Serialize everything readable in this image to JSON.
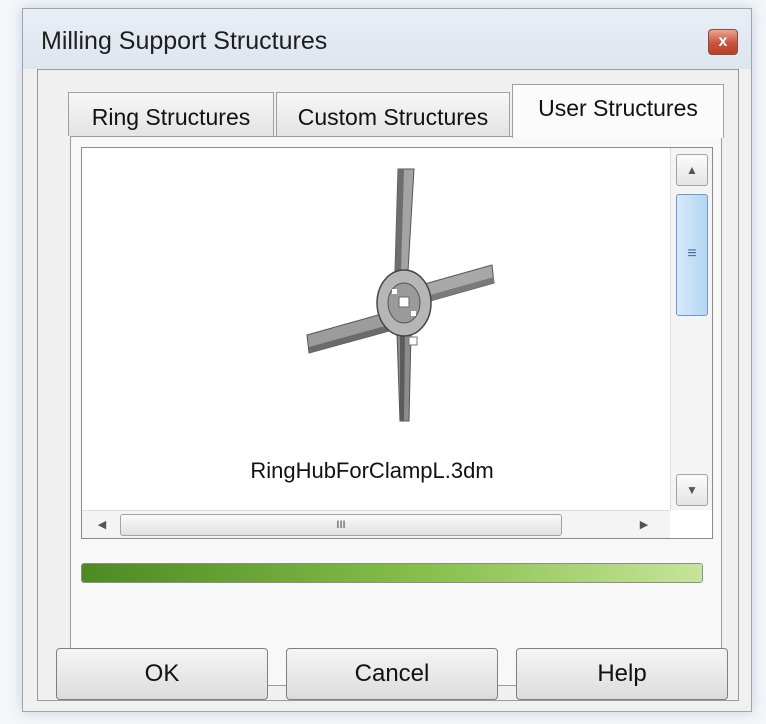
{
  "window": {
    "title": "Milling Support Structures",
    "close_label": "x"
  },
  "tabs": [
    {
      "label": "Ring Structures",
      "active": false
    },
    {
      "label": "Custom Structures",
      "active": false
    },
    {
      "label": "User Structures",
      "active": true
    }
  ],
  "viewer": {
    "thumbnail_icon": "four-arm-ring-hub-icon",
    "filename": "RingHubForClampL.3dm",
    "hscroll_grip": "III",
    "vscroll_grip": "≡"
  },
  "progress": {
    "fraction": 1.0,
    "colors": {
      "fill_start": "#4d8a22",
      "fill_end": "#c6e49a"
    }
  },
  "buttons": {
    "ok": "OK",
    "cancel": "Cancel",
    "help": "Help"
  }
}
